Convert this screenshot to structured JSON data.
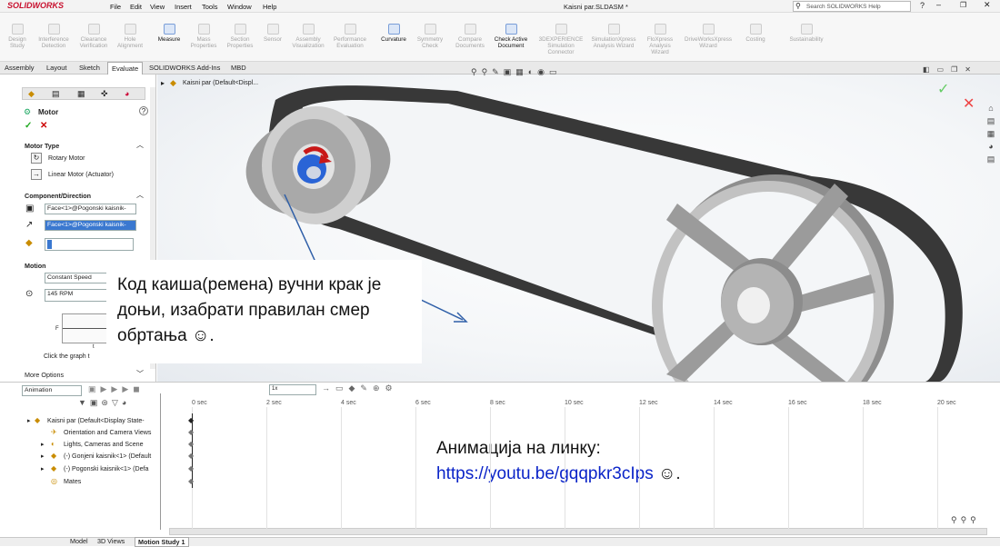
{
  "app": {
    "brand": "SOLIDWORKS",
    "title": "Kaisni par.SLDASM *",
    "search": "Search SOLIDWORKS Help"
  },
  "menu": [
    "File",
    "Edit",
    "View",
    "Insert",
    "Tools",
    "Window",
    "Help"
  ],
  "ribbon": [
    {
      "label": "Design Study",
      "on": false
    },
    {
      "label": "Interference Detection",
      "on": false
    },
    {
      "label": "Clearance Verification",
      "on": false
    },
    {
      "label": "Hole Alignment",
      "on": false
    },
    {
      "label": "Measure",
      "on": true
    },
    {
      "label": "Mass Properties",
      "on": false
    },
    {
      "label": "Section Properties",
      "on": false
    },
    {
      "label": "Sensor",
      "on": false
    },
    {
      "label": "Assembly Visualization",
      "on": false
    },
    {
      "label": "Performance Evaluation",
      "on": false
    },
    {
      "label": "Curvature",
      "on": true
    },
    {
      "label": "Symmetry Check",
      "on": false
    },
    {
      "label": "Compare Documents",
      "on": false
    },
    {
      "label": "Check Active Document",
      "on": true
    },
    {
      "label": "3DEXPERIENCE Simulation Connector",
      "on": false
    },
    {
      "label": "SimulationXpress Analysis Wizard",
      "on": false
    },
    {
      "label": "FloXpress Analysis Wizard",
      "on": false
    },
    {
      "label": "DriveWorksXpress Wizard",
      "on": false
    },
    {
      "label": "Costing",
      "on": false
    },
    {
      "label": "Sustainability",
      "on": false
    }
  ],
  "tabs": [
    "Assembly",
    "Layout",
    "Sketch",
    "Evaluate",
    "SOLIDWORKS Add-Ins",
    "MBD"
  ],
  "active_tab": "Evaluate",
  "pm": {
    "title": "Motor",
    "motor_type_header": "Motor Type",
    "rotary": "Rotary Motor",
    "linear": "Linear Motor (Actuator)",
    "component_header": "Component/Direction",
    "face1": "Face<1>@Pogonski kaisnik-",
    "face2": "Face<1>@Pogonski kaisnik-",
    "motion_header": "Motion",
    "motion_type": "Constant Speed",
    "speed": "145 RPM",
    "graph_hint": "Click the graph t",
    "graph_f": "F",
    "graph_t": "t",
    "more": "More Options"
  },
  "tree_top": "Kaisni par  (Default<Displ...",
  "callouts": {
    "main": "Код каиша(ремена) вучни крак је доњи, изабрати правилан смер обртања ☺.",
    "anim_label": "Анимација на линку:",
    "anim_link": "https://youtu.be/gqqpkr3cIps",
    "anim_tail": " ☺."
  },
  "timeline": {
    "dropdown": "Animation",
    "ticks": [
      "0 sec",
      "2 sec",
      "4 sec",
      "6 sec",
      "8 sec",
      "10 sec",
      "12 sec",
      "14 sec",
      "16 sec",
      "18 sec",
      "20 sec"
    ]
  },
  "mtree": [
    "Kaisni par  (Default<Display State-",
    "Orientation and Camera Views",
    "Lights, Cameras and Scene",
    "(-) Gonjeni kaisnik<1> (Default",
    "(-) Pogonski kaisnik<1> (Defa",
    "Mates"
  ],
  "bottom_tabs": [
    "Model",
    "3D Views",
    "Motion Study 1"
  ],
  "colors": {
    "belt": "#3a3a3a",
    "pulley": "#bdbdbd",
    "text_blue": "#2d2de0",
    "link": "#0b24c8"
  }
}
